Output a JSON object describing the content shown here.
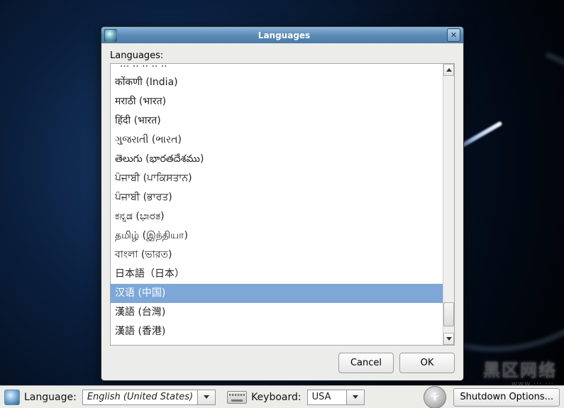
{
  "dialog": {
    "title": "Languages",
    "list_label": "Languages:",
    "partial_top": "ˇ··· ·· ·· ·· ··",
    "items": [
      "कोंकणी (India)",
      "मराठी (भारत)",
      "हिंदी (भारत)",
      "ગુજરાતી (ભારત)",
      "తెలుగు (భారతదేశము)",
      "ਪੰਜਾਬੀ (ਪਾਕਿਸਤਾਨ)",
      "ਪੰਜਾਬੀ (ਭਾਰਤ)",
      "ಕನ್ನಡ (ಭಾರತ)",
      "தமிழ் (இந்தியா)",
      "বাংলা (ভারত)",
      "日本語（日本）",
      "汉语 (中国)",
      "漢語 (台灣)",
      "漢語 (香港)"
    ],
    "selected_index": 11,
    "cancel_label": "Cancel",
    "ok_label": "OK"
  },
  "panel": {
    "language_label": "Language:",
    "language_value": "English (United States)",
    "keyboard_label": "Keyboard:",
    "keyboard_value": "USA",
    "shutdown_label": "Shutdown Options..."
  },
  "watermark": {
    "main": "黑区网络",
    "sub": "www.···.···"
  }
}
